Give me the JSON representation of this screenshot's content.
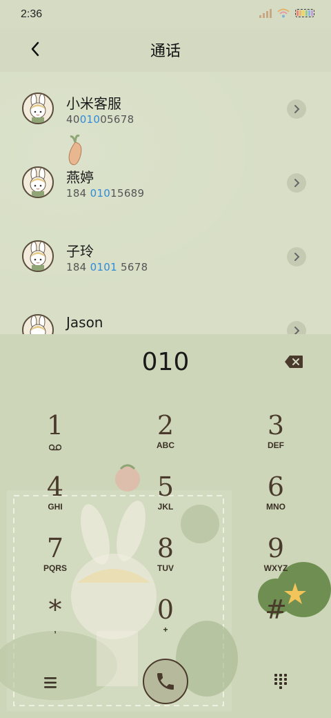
{
  "status": {
    "time": "2:36"
  },
  "header": {
    "title": "通话"
  },
  "contacts": [
    {
      "name": "小米客服",
      "number_parts": [
        "40",
        "010",
        "05678"
      ]
    },
    {
      "name": "燕婷",
      "number_parts": [
        "184 ",
        "010",
        "15689"
      ]
    },
    {
      "name": "子玲",
      "number_parts": [
        "184 ",
        "0101",
        " 5678"
      ]
    },
    {
      "name": "Jason",
      "number_parts": [
        "",
        "",
        ""
      ]
    }
  ],
  "dialer": {
    "input": "010",
    "keys": [
      {
        "digit": "1",
        "letters": ""
      },
      {
        "digit": "2",
        "letters": "ABC"
      },
      {
        "digit": "3",
        "letters": "DEF"
      },
      {
        "digit": "4",
        "letters": "GHI"
      },
      {
        "digit": "5",
        "letters": "JKL"
      },
      {
        "digit": "6",
        "letters": "MNO"
      },
      {
        "digit": "7",
        "letters": "PQRS"
      },
      {
        "digit": "8",
        "letters": "TUV"
      },
      {
        "digit": "9",
        "letters": "WXYZ"
      },
      {
        "digit": "*",
        "letters": ","
      },
      {
        "digit": "0",
        "letters": "+"
      },
      {
        "digit": "#",
        "letters": ""
      }
    ]
  },
  "colors": {
    "highlight": "#2f8ad8",
    "accent": "#4a3a2c",
    "background": "#d5dcc3"
  },
  "icons": {
    "back": "chevron-left-icon",
    "row_arrow": "chevron-right-icon",
    "backspace": "backspace-icon",
    "voicemail": "voicemail-icon",
    "menu": "menu-icon",
    "call": "phone-icon",
    "keypad": "keypad-icon"
  }
}
